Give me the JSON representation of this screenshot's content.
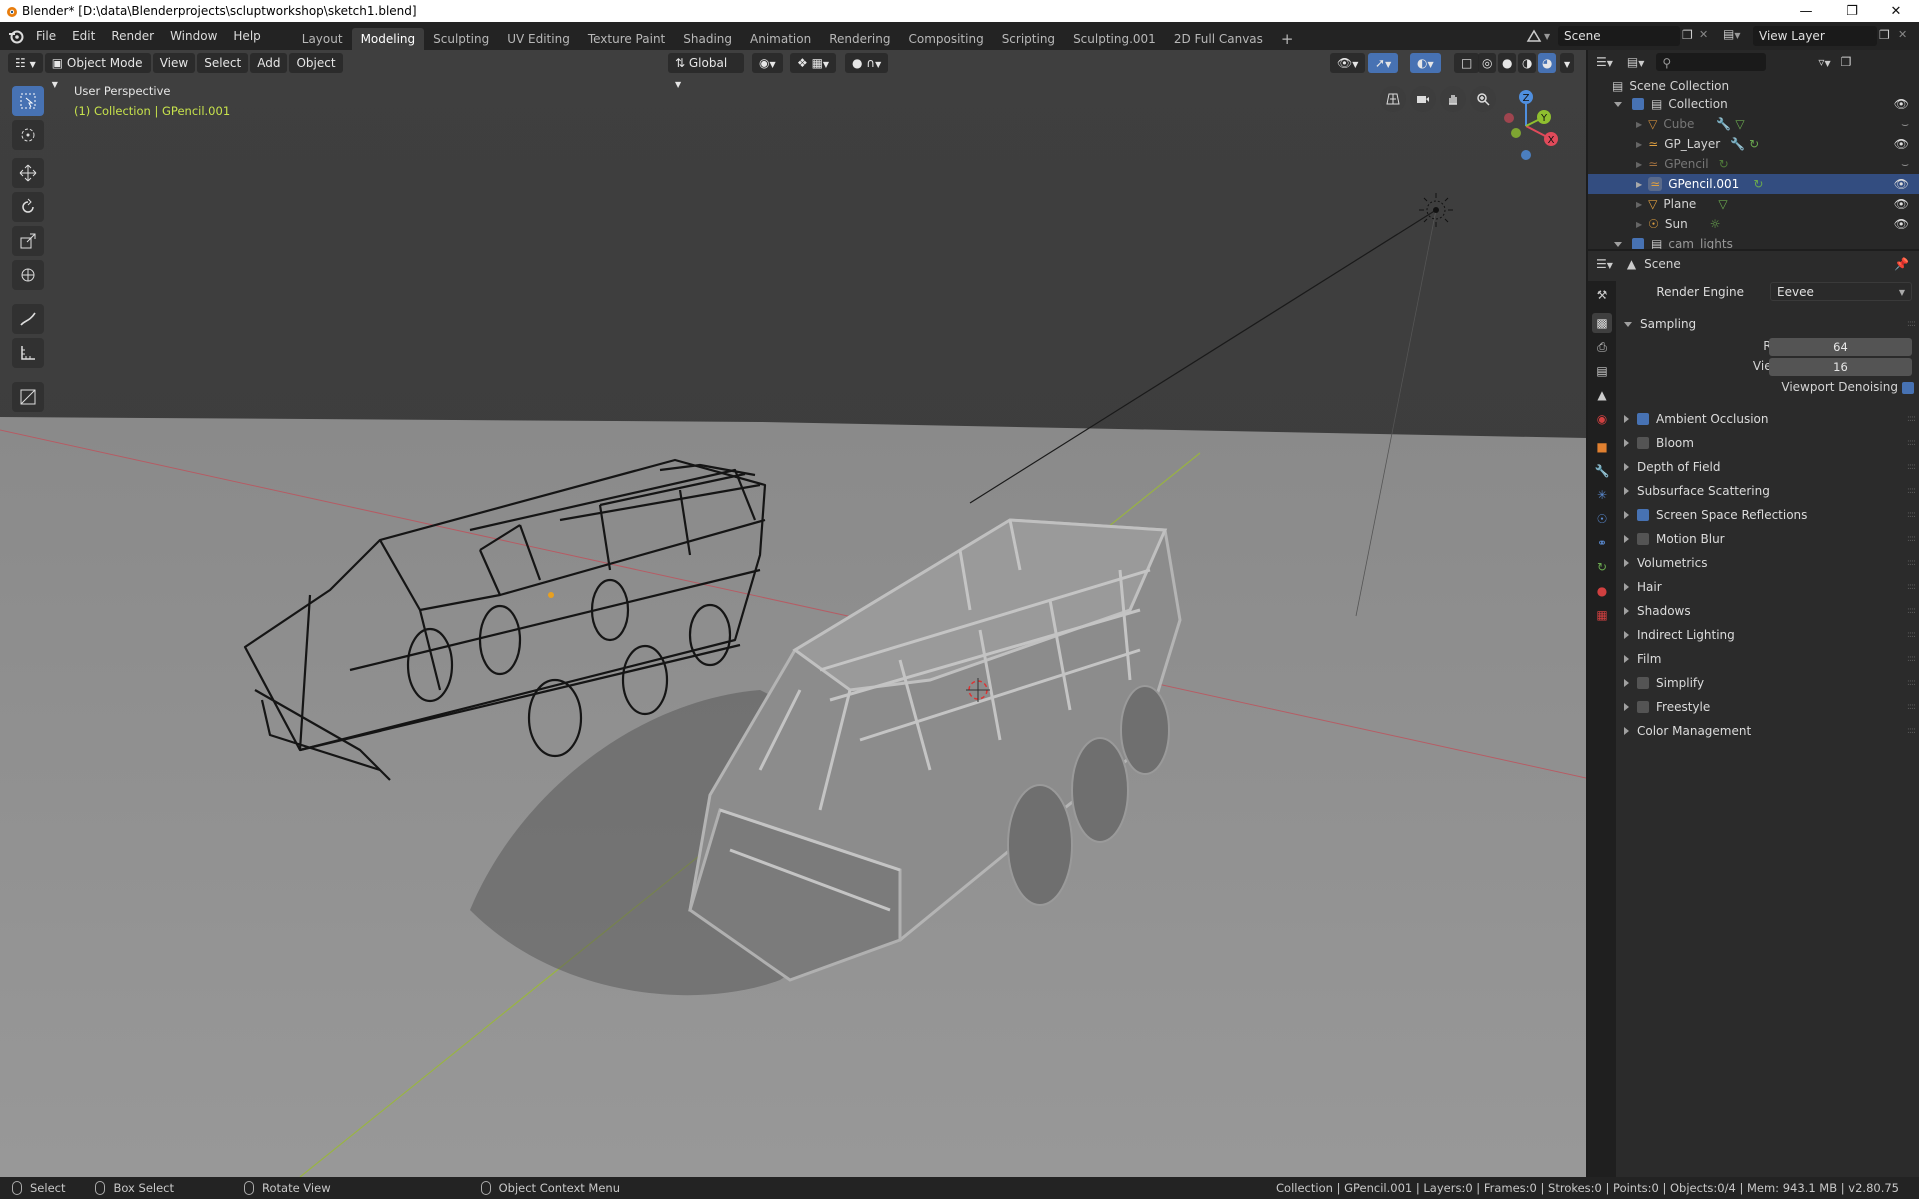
{
  "window": {
    "title": "Blender* [D:\\data\\Blenderprojects\\scluptworkshop\\sketch1.blend]"
  },
  "menu": [
    "File",
    "Edit",
    "Render",
    "Window",
    "Help"
  ],
  "workspaces": [
    "Layout",
    "Modeling",
    "Sculpting",
    "UV Editing",
    "Texture Paint",
    "Shading",
    "Animation",
    "Rendering",
    "Compositing",
    "Scripting",
    "Sculpting.001",
    "2D Full Canvas"
  ],
  "active_workspace": "Modeling",
  "scene_field": "Scene",
  "view_layer_field": "View Layer",
  "viewport": {
    "mode": "Object Mode",
    "menus": [
      "View",
      "Select",
      "Add",
      "Object"
    ],
    "transform_orientation": "Global",
    "overlay_title": "User Perspective",
    "overlay_collection": "(1) Collection | GPencil.001",
    "gizmo": {
      "x": "X",
      "y": "Y",
      "z": "Z"
    }
  },
  "outliner": {
    "root": "Scene Collection",
    "collection": "Collection",
    "items": [
      {
        "name": "Cube",
        "dim": true
      },
      {
        "name": "GP_Layer",
        "dim": false
      },
      {
        "name": "GPencil",
        "dim": true
      },
      {
        "name": "GPencil.001",
        "dim": false,
        "selected": true
      },
      {
        "name": "Plane",
        "dim": false
      },
      {
        "name": "Sun",
        "dim": false
      },
      {
        "name": "cam_lights",
        "dim": false
      }
    ]
  },
  "properties": {
    "context": "Scene",
    "render_engine_label": "Render Engine",
    "render_engine": "Eevee",
    "sampling_label": "Sampling",
    "render_label": "Render",
    "render_samples": "64",
    "viewport_label": "Viewport",
    "viewport_samples": "16",
    "viewport_denoising": "Viewport Denoising",
    "panels": [
      {
        "label": "Ambient Occlusion",
        "checkbox": true,
        "checked": true
      },
      {
        "label": "Bloom",
        "checkbox": true,
        "checked": false
      },
      {
        "label": "Depth of Field",
        "checkbox": false
      },
      {
        "label": "Subsurface Scattering",
        "checkbox": false
      },
      {
        "label": "Screen Space Reflections",
        "checkbox": true,
        "checked": true
      },
      {
        "label": "Motion Blur",
        "checkbox": true,
        "checked": false
      },
      {
        "label": "Volumetrics",
        "checkbox": false
      },
      {
        "label": "Hair",
        "checkbox": false
      },
      {
        "label": "Shadows",
        "checkbox": false
      },
      {
        "label": "Indirect Lighting",
        "checkbox": false
      },
      {
        "label": "Film",
        "checkbox": false
      },
      {
        "label": "Simplify",
        "checkbox": true,
        "checked": false
      },
      {
        "label": "Freestyle",
        "checkbox": true,
        "checked": false
      },
      {
        "label": "Color Management",
        "checkbox": false
      }
    ]
  },
  "statusbar": {
    "select": "Select",
    "box_select": "Box Select",
    "rotate_view": "Rotate View",
    "context_menu": "Object Context Menu",
    "info": "Collection | GPencil.001 | Layers:0 | Frames:0 | Strokes:0 | Points:0 | Objects:0/4 | Mem: 943.1 MB | v2.80.75"
  },
  "colors": {
    "accent": "#4772b3",
    "selected_row": "#334d80",
    "axis_x": "#e04a5a",
    "axis_y": "#8fbf2f",
    "axis_z": "#4f8fdf"
  }
}
